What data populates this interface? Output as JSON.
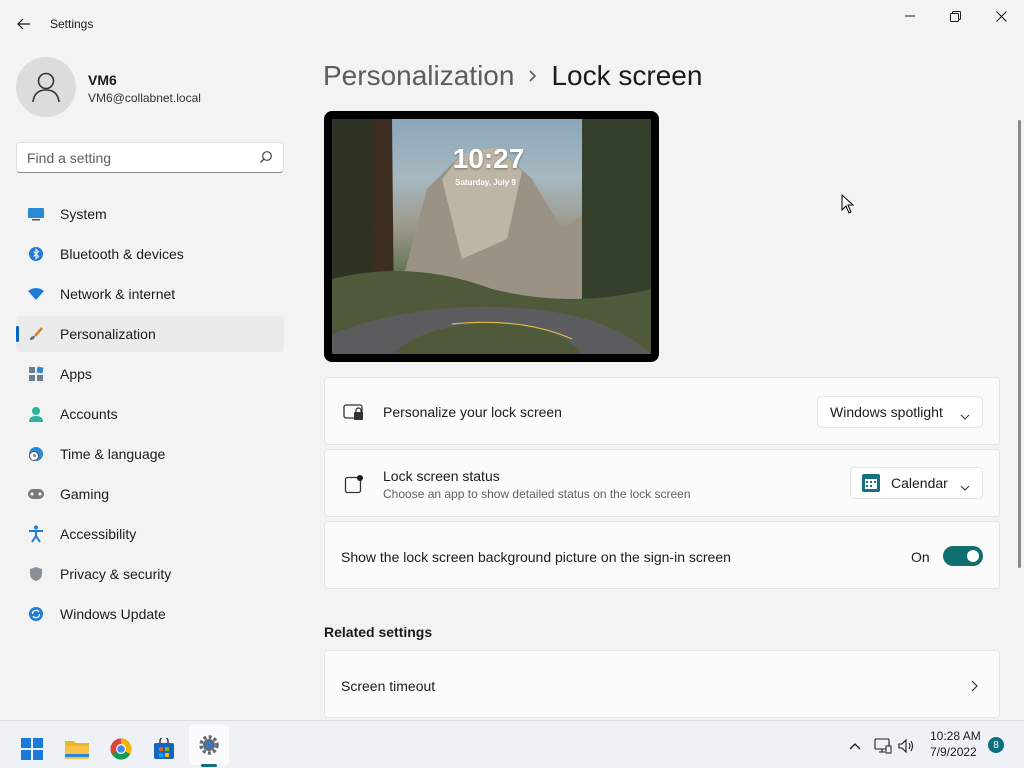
{
  "window": {
    "title": "Settings"
  },
  "user": {
    "name": "VM6",
    "email": "VM6@collabnet.local"
  },
  "search": {
    "placeholder": "Find a setting"
  },
  "nav": {
    "items": [
      {
        "label": "System",
        "icon": "monitor-icon"
      },
      {
        "label": "Bluetooth & devices",
        "icon": "bluetooth-icon"
      },
      {
        "label": "Network & internet",
        "icon": "wifi-icon"
      },
      {
        "label": "Personalization",
        "icon": "brush-icon",
        "active": true
      },
      {
        "label": "Apps",
        "icon": "apps-icon"
      },
      {
        "label": "Accounts",
        "icon": "person-icon"
      },
      {
        "label": "Time & language",
        "icon": "clock-globe-icon"
      },
      {
        "label": "Gaming",
        "icon": "gamepad-icon"
      },
      {
        "label": "Accessibility",
        "icon": "accessibility-icon"
      },
      {
        "label": "Privacy & security",
        "icon": "shield-icon"
      },
      {
        "label": "Windows Update",
        "icon": "update-icon"
      }
    ]
  },
  "breadcrumb": {
    "parent": "Personalization",
    "current": "Lock screen"
  },
  "preview": {
    "time": "10:27",
    "date": "Saturday, July 9"
  },
  "settings": {
    "personalize": {
      "title": "Personalize your lock screen",
      "value": "Windows spotlight"
    },
    "status": {
      "title": "Lock screen status",
      "subtitle": "Choose an app to show detailed status on the lock screen",
      "value": "Calendar"
    },
    "signin_bg": {
      "title": "Show the lock screen background picture on the sign-in screen",
      "state_label": "On",
      "on": true
    }
  },
  "related": {
    "title": "Related settings",
    "items": [
      {
        "label": "Screen timeout"
      }
    ]
  },
  "taskbar": {
    "apps": [
      "start-icon",
      "file-explorer-icon",
      "chrome-icon",
      "store-icon",
      "settings-icon"
    ],
    "clock_time": "10:28 AM",
    "clock_date": "7/9/2022",
    "notification_count": "8"
  },
  "colors": {
    "accent": "#0067c0",
    "toggle_on": "#0f6e6e"
  }
}
